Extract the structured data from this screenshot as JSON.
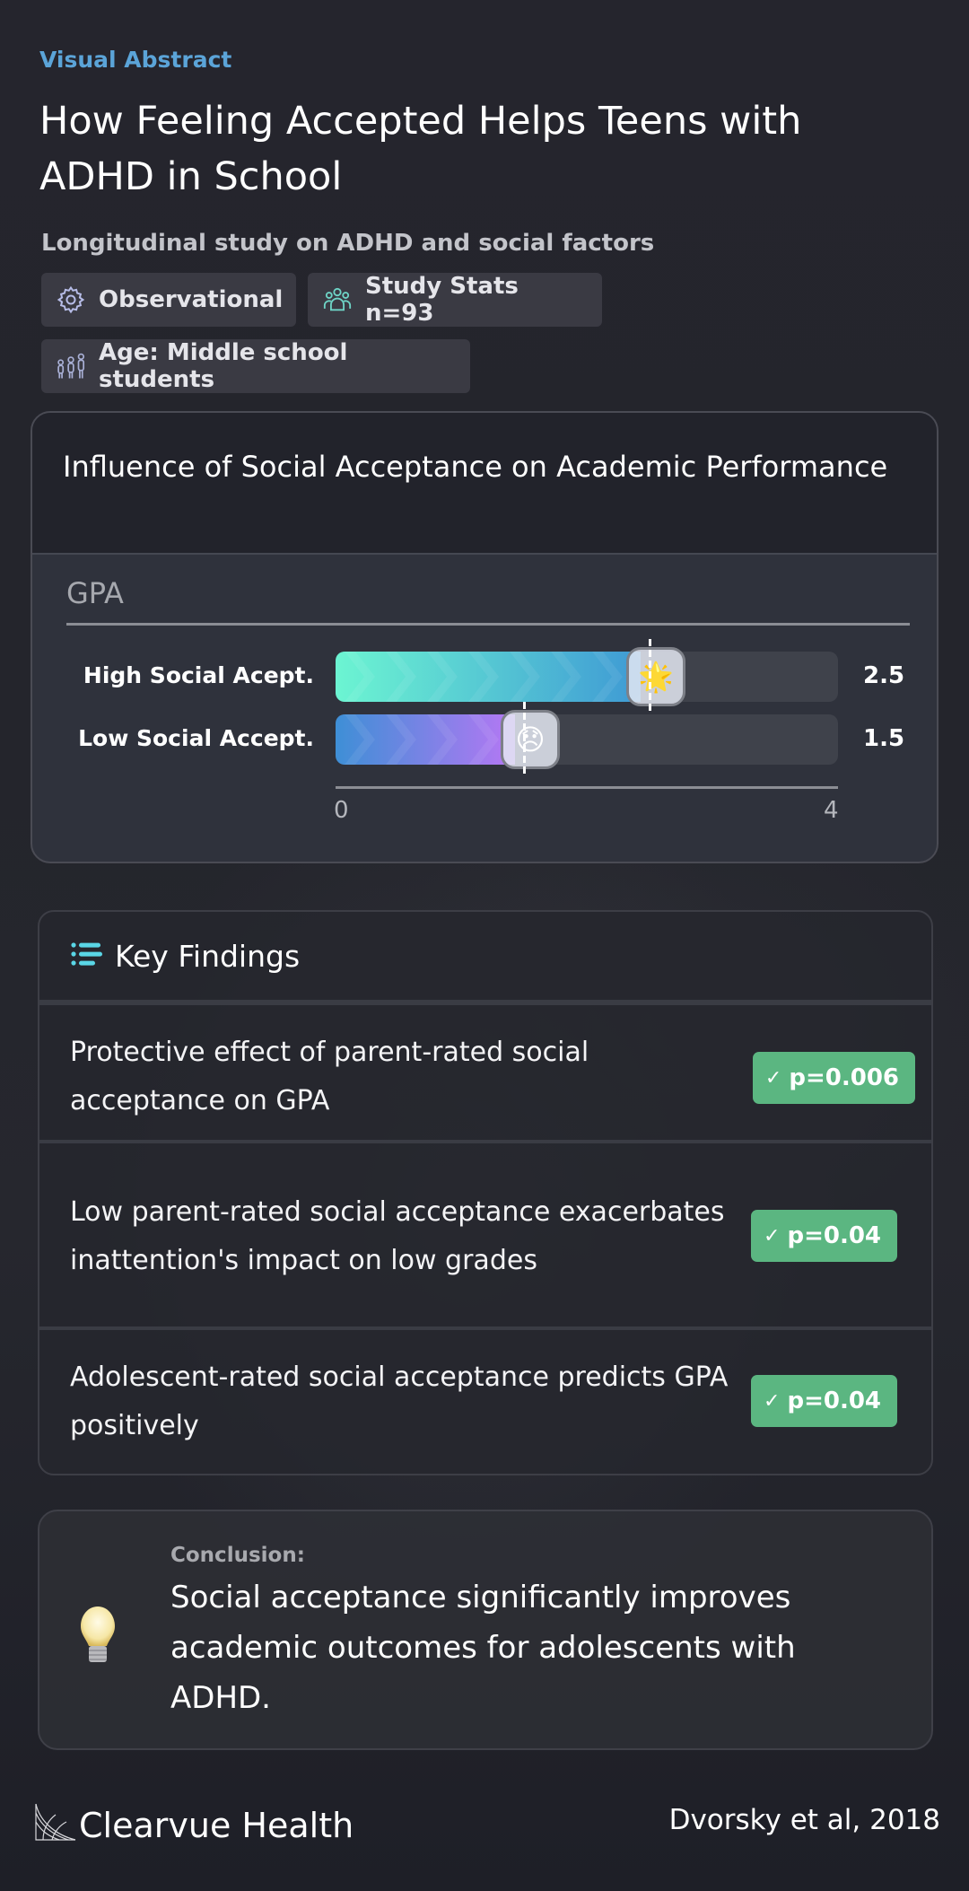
{
  "header": {
    "eyebrow": "Visual Abstract",
    "title": "How Feeling Accepted Helps Teens with ADHD in School",
    "subtitle": "Longitudinal study on ADHD and social factors",
    "chips": [
      {
        "icon": "gear-icon",
        "label": "Observational"
      },
      {
        "icon": "people-group-icon",
        "label": "Study Stats n=93"
      },
      {
        "icon": "family-icon",
        "label": "Age: Middle school students"
      }
    ]
  },
  "chart_data": {
    "type": "bar",
    "orientation": "horizontal",
    "title": "Influence of Social Acceptance on Academic Performance",
    "metric_label": "GPA",
    "categories": [
      "High Social Acept.",
      "Low Social Accept."
    ],
    "values": [
      2.5,
      1.5
    ],
    "value_labels": [
      "2.5",
      "1.5"
    ],
    "markers": [
      "🌟",
      "😞"
    ],
    "xlim": [
      0,
      4
    ],
    "xticks": [
      "0",
      "4"
    ],
    "xlabel": "",
    "ylabel": "",
    "grid": false,
    "colors": [
      {
        "start": "#6cf5d2",
        "end": "#3f9ad4"
      },
      {
        "start": "#3e8fd6",
        "end": "#b677f4"
      }
    ]
  },
  "findings": {
    "title": "Key Findings",
    "icon": "list-icon",
    "items": [
      {
        "text": "Protective effect of parent-rated social acceptance on GPA",
        "badge": "p=0.006"
      },
      {
        "text": "Low parent-rated social acceptance exacerbates inattention's impact on low grades",
        "badge": "p=0.04"
      },
      {
        "text": "Adolescent-rated social acceptance predicts GPA positively",
        "badge": "p=0.04"
      }
    ],
    "badge_icon": "✓",
    "badge_color": "#5bb681"
  },
  "conclusion": {
    "label": "Conclusion:",
    "text": "Social acceptance significantly improves academic outcomes for adolescents with ADHD."
  },
  "footer": {
    "brand": "Clearvue Health",
    "citation": "Dvorsky et al, 2018"
  },
  "colors": {
    "accent": "#5ba4d8",
    "background": "#25252d",
    "list_icon": "#5ad6e6"
  }
}
